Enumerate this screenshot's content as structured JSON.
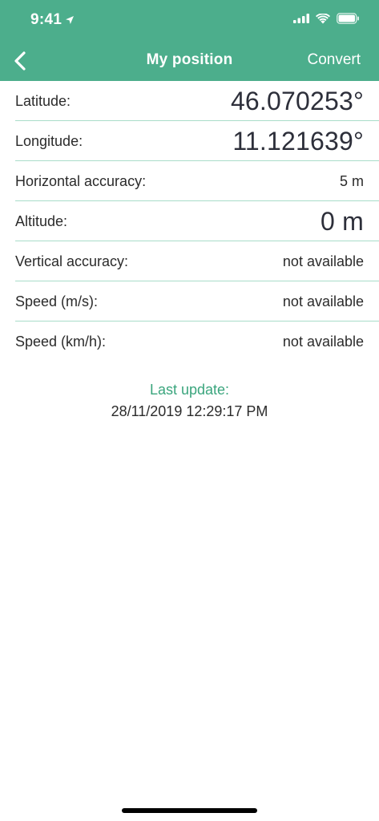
{
  "status_bar": {
    "time": "9:41"
  },
  "nav": {
    "title": "My position",
    "convert_label": "Convert"
  },
  "rows": [
    {
      "label": "Latitude:",
      "value": "46.070253°"
    },
    {
      "label": "Longitude:",
      "value": "11.121639°"
    },
    {
      "label": "Horizontal accuracy:",
      "value": "5 m"
    },
    {
      "label": "Altitude:",
      "value": "0 m"
    },
    {
      "label": "Vertical accuracy:",
      "value": "not available"
    },
    {
      "label": "Speed (m/s):",
      "value": "not available"
    },
    {
      "label": "Speed (km/h):",
      "value": "not available"
    }
  ],
  "last_update": {
    "label": "Last update:",
    "value": "28/11/2019 12:29:17 PM"
  },
  "colors": {
    "header_background": "#4cae8c",
    "accent": "#3aa57d",
    "divider": "#a9dcc9"
  },
  "icons": {
    "back": "chevron-left-icon",
    "location": "location-arrow-icon",
    "signal": "cellular-signal-icon",
    "wifi": "wifi-icon",
    "battery": "battery-icon"
  }
}
